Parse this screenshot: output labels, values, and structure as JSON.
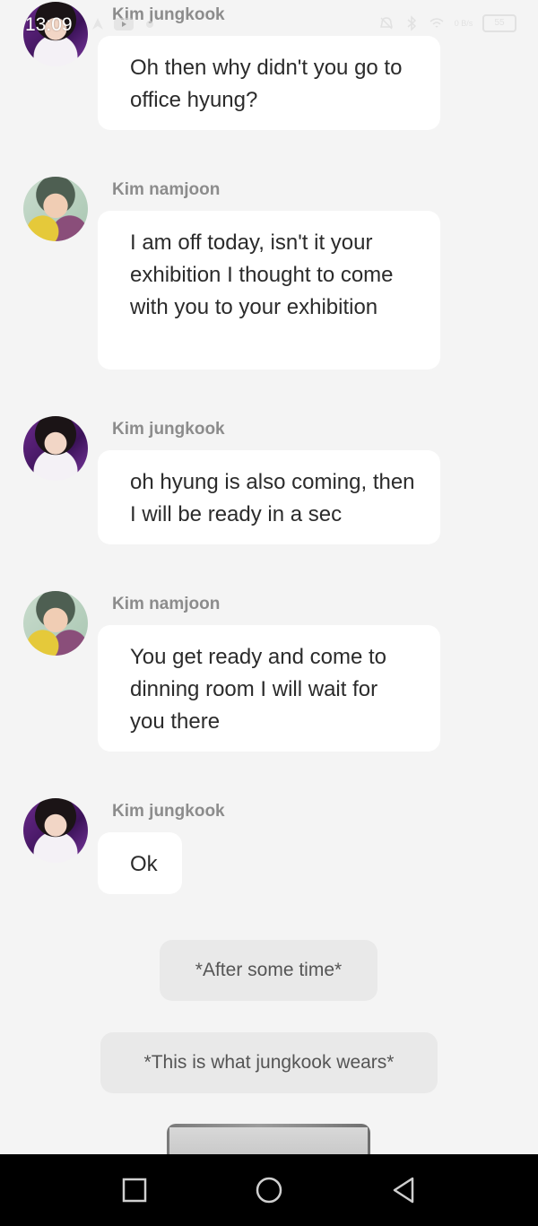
{
  "status_bar": {
    "time": "13:09",
    "battery_level": "55",
    "network_speed": "0 B/s"
  },
  "messages": [
    {
      "sender": "Kim jungkook",
      "avatar": "jungkook-avatar",
      "text": "Oh then why didn't you go to office hyung?"
    },
    {
      "sender": "Kim namjoon",
      "avatar": "namjoon-avatar",
      "text": "I am off today, isn't it your exhibition I thought to come with you to your exhibition"
    },
    {
      "sender": "Kim jungkook",
      "avatar": "jungkook-avatar",
      "text": "oh hyung is also coming, then I will be ready in a sec"
    },
    {
      "sender": "Kim namjoon",
      "avatar": "namjoon-avatar",
      "text": "You get ready and come to dinning room I will wait for you there"
    },
    {
      "sender": "Kim jungkook",
      "avatar": "jungkook-avatar",
      "text": "Ok"
    }
  ],
  "narrations": [
    "*After some time*",
    "*This is what jungkook wears*"
  ],
  "nav_bar": {
    "recents_icon": "square-icon",
    "home_icon": "circle-icon",
    "back_icon": "triangle-back-icon"
  },
  "colors": {
    "background": "#f4f4f4",
    "bubble": "#ffffff",
    "narration": "#e9e9e9",
    "sender": "#8c8c8c",
    "nav_bar": "#000000"
  }
}
